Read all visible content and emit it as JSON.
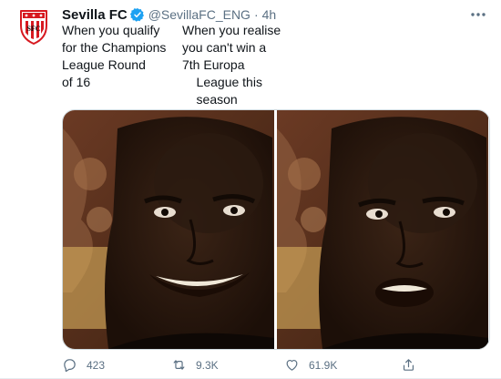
{
  "tweet": {
    "display_name": "Sevilla FC",
    "handle": "@SevillaFC_ENG",
    "separator": "·",
    "time": "4h",
    "caption_left": "When you qualify\nfor the Champions\nLeague Round\nof 16",
    "caption_right": "When you realise\nyou can't win a\n7th Europa\n    League this\n    season"
  },
  "actions": {
    "replies": "423",
    "retweets": "9.3K",
    "likes": "61.9K"
  },
  "colors": {
    "verified_badge": "#1da1f2",
    "secondary_text": "#5b7083",
    "crest_red": "#d71920"
  }
}
